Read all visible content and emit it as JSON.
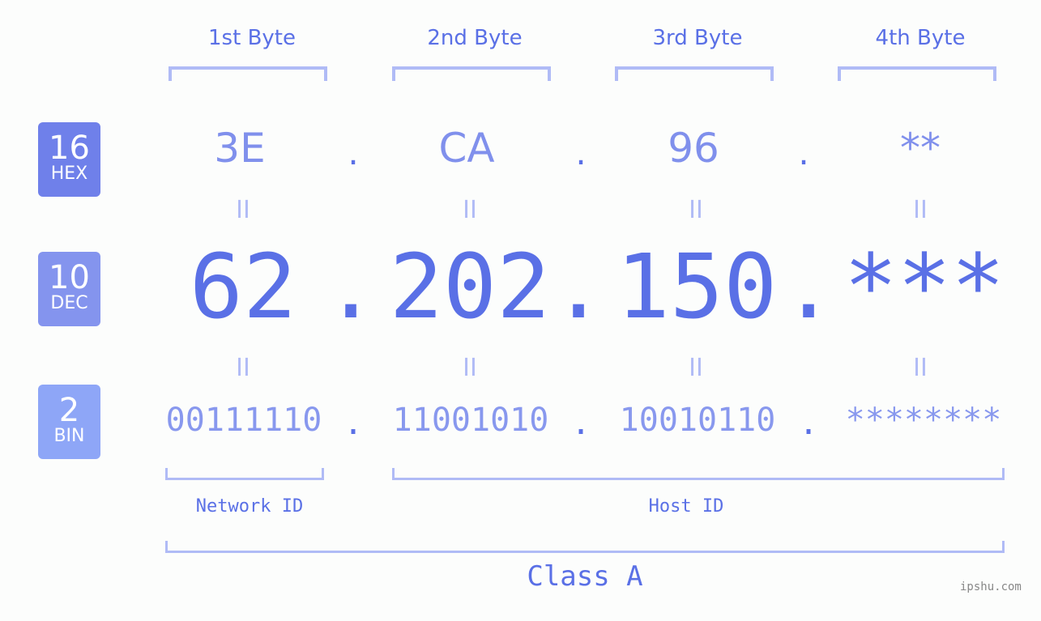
{
  "headers": [
    "1st Byte",
    "2nd Byte",
    "3rd Byte",
    "4th Byte"
  ],
  "badges": {
    "hex": {
      "number": "16",
      "label": "HEX",
      "color": "#6f80ea"
    },
    "dec": {
      "number": "10",
      "label": "DEC",
      "color": "#8494ee"
    },
    "bin": {
      "number": "2",
      "label": "BIN",
      "color": "#8ea6f7"
    }
  },
  "hex_values": [
    "3E",
    "CA",
    "96",
    "**"
  ],
  "dec_values": [
    "62",
    "202",
    "150",
    "***"
  ],
  "bin_values": [
    "00111110",
    "11001010",
    "10010110",
    "********"
  ],
  "separator": ".",
  "equals": "II",
  "network_label": "Network ID",
  "host_label": "Host ID",
  "class_label": "Class A",
  "watermark": "ipshu.com",
  "colors": {
    "primary": "#5a70e6",
    "light": "#b0bbf6",
    "background": "#fcfdfc"
  }
}
